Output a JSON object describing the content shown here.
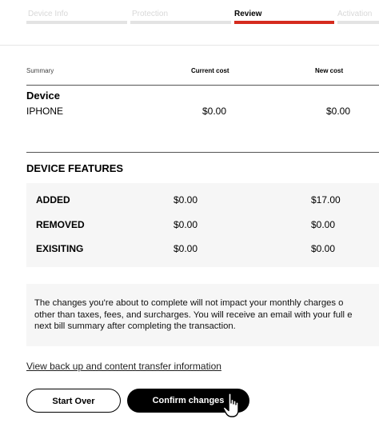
{
  "progress": {
    "steps": [
      {
        "label": "Device Info",
        "active": false
      },
      {
        "label": "Protection",
        "active": false
      },
      {
        "label": "Review",
        "active": true
      },
      {
        "label": "Activation",
        "active": false
      }
    ]
  },
  "summary": {
    "header_label": "Summary",
    "current_cost_label": "Current cost",
    "new_cost_label": "New cost",
    "device": {
      "title": "Device",
      "name": "IPHONE",
      "current_cost": "$0.00",
      "new_cost": "$0.00"
    }
  },
  "features": {
    "title": "DEVICE FEATURES",
    "rows": [
      {
        "label": "ADDED",
        "current": "$0.00",
        "new": "$17.00"
      },
      {
        "label": "REMOVED",
        "current": "$0.00",
        "new": "$0.00"
      },
      {
        "label": "EXISITING",
        "current": "$0.00",
        "new": "$0.00"
      }
    ]
  },
  "notice": {
    "line1": "The changes you're about to complete will not impact your monthly charges o",
    "line2": "other than taxes, fees, and surcharges. You will receive an email with your full e",
    "line3": "next bill summary after completing the transaction."
  },
  "transfer_link": "View back up and content transfer information",
  "buttons": {
    "start_over": "Start Over",
    "confirm": "Confirm changes"
  },
  "colors": {
    "accent": "#d52b1e",
    "panel": "#f6f6f6"
  }
}
